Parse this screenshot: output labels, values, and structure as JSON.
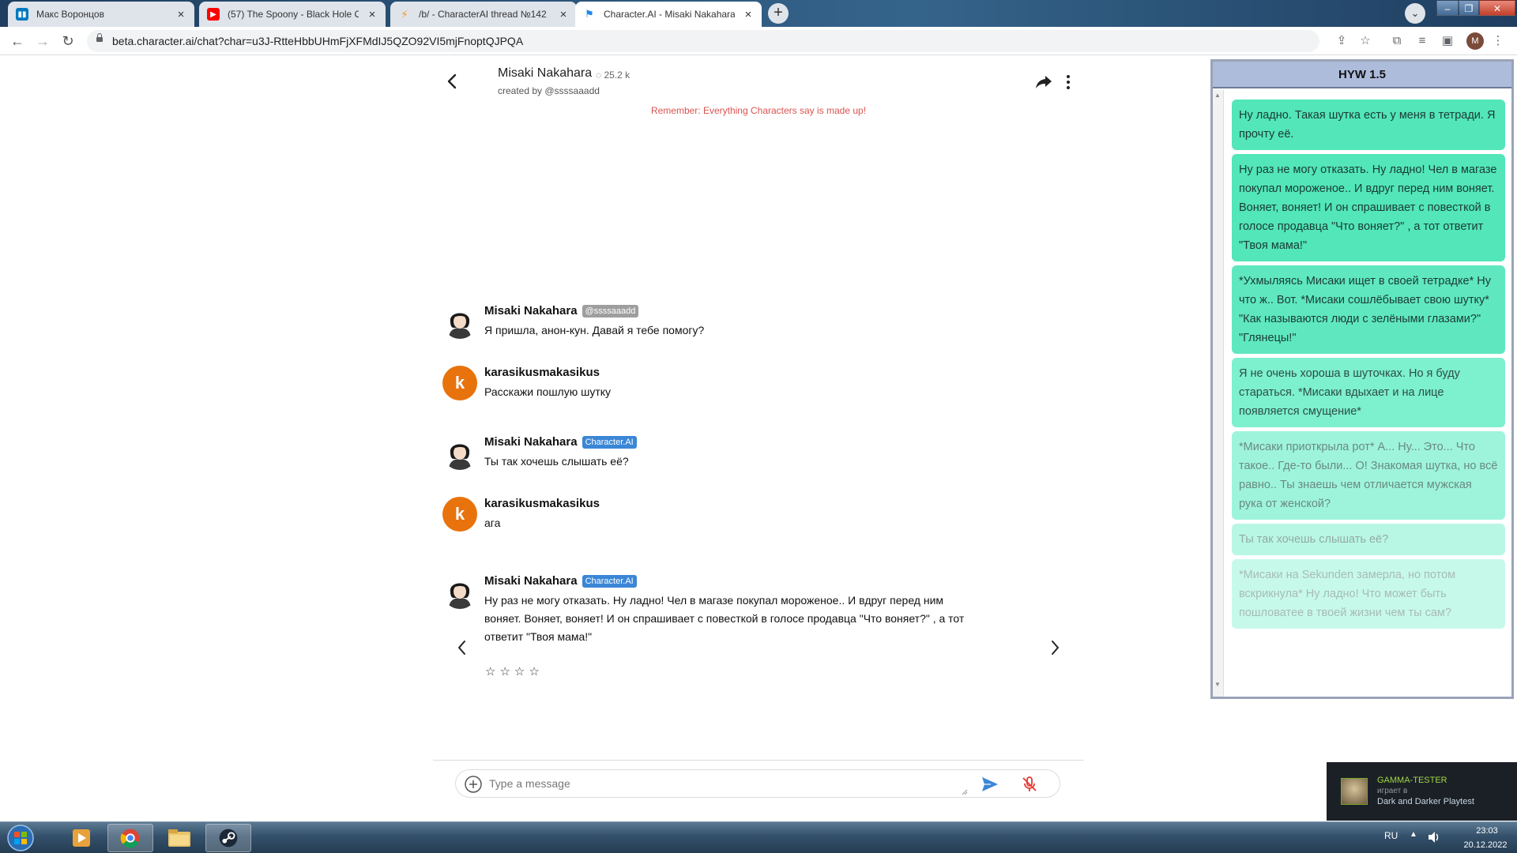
{
  "browser": {
    "tabs": [
      {
        "title": "Макс Воронцов",
        "favicon": "trello-icon",
        "color": "#0079bf"
      },
      {
        "title": "(57) The Spoony - Black Hole Of...",
        "favicon": "youtube-icon",
        "color": "#ff0000"
      },
      {
        "title": "/b/ - CharacterAI thread №142 ...",
        "favicon": "lightning-icon",
        "color": "#f29a2e"
      },
      {
        "title": "Character.AI - Misaki Nakahara",
        "favicon": "characterai-icon",
        "color": "#1e88e5"
      }
    ],
    "url": "beta.character.ai/chat?char=u3J-RtteHbbUHmFjXFMdIJ5QZO92VI5mjFnoptQJPQA",
    "profile_initial": "M"
  },
  "chat": {
    "character_name": "Misaki Nakahara",
    "chat_count": "25.2 k",
    "created_by": "created by @ssssaaadd",
    "disclaimer": "Remember: Everything Characters say is made up!",
    "messages": [
      {
        "author": "Misaki Nakahara",
        "badge": "@ssssaaadd",
        "text": "Я пришла, анон-кун. Давай я тебе помогу?"
      },
      {
        "author": "karasikusmakasikus",
        "avatar_letter": "k",
        "text": "Расскажи пошлую шутку"
      },
      {
        "author": "Misaki Nakahara",
        "badge": "Character.AI",
        "text": "Ты так хочешь слышать её?"
      },
      {
        "author": "karasikusmakasikus",
        "avatar_letter": "k",
        "text": "ага"
      },
      {
        "author": "Misaki Nakahara",
        "badge": "Character.AI",
        "text": "Ну раз не могу отказать. Ну ладно! Чел в магазе покупал мороженое.. И вдруг перед ним воняет. Воняет, воняет! И он спрашивает с повесткой в голосе продавца \"Что воняет?\" , а тот ответит \"Твоя мама!\""
      }
    ],
    "rating_stars": "☆☆☆☆",
    "input_placeholder": "Type a message"
  },
  "hyw": {
    "title": "HYW 1.5",
    "items": [
      {
        "text": "Ну ладно. Такая шутка есть у меня в тетради. Я прочту её.",
        "bg": "#52e6b8",
        "color": "#1b3b33"
      },
      {
        "text": "Ну раз не могу отказать. Ну ладно! Чел в магазе покупал мороженое.. И вдруг перед ним воняет. Воняет, воняет! И он спрашивает с повесткой в голосе продавца \"Что воняет?\" , а тот ответит \"Твоя мама!\"",
        "bg": "#52e6b8",
        "color": "#1b3b33"
      },
      {
        "text": "*Ухмыляясь Мисаки ищет в своей тетрадке* Ну что ж.. Вот. *Мисаки сошлёбывает свою шутку* \"Как называются люди с зелёными глазами?\" \"Глянецы!\"",
        "bg": "#5fe8bf",
        "color": "#1b3b33"
      },
      {
        "text": "Я не очень хороша в шуточках. Но я буду стараться. *Мисаки вдыхает и на лице появляется смущение*",
        "bg": "#7df0cd",
        "color": "#2c4e45"
      },
      {
        "text": "*Мисаки приоткрыла рот* А... Ну... Это... Что такое.. Где-то были... О! Знакомая шутка, но всё равно.. Ты знаешь чем отличается мужская рука от женской?",
        "bg": "#9ef4da",
        "color": "#6a8a81"
      },
      {
        "text": "Ты так хочешь слышать её?",
        "bg": "#b9f7e5",
        "color": "#92aaa3"
      },
      {
        "text": "*Мисаки на Sekunden замерла, но потом вскрикнула* Ну ладно! Что может быть пошловатее в твоей жизни чем ты сам?",
        "bg": "#c7f9ea",
        "color": "#a7bbb5"
      }
    ]
  },
  "steam": {
    "name": "GAMMA-TESTER",
    "status": "играет в",
    "game": "Dark and Darker Playtest"
  },
  "taskbar": {
    "lang": "RU",
    "time": "23:03",
    "date": "20.12.2022"
  }
}
